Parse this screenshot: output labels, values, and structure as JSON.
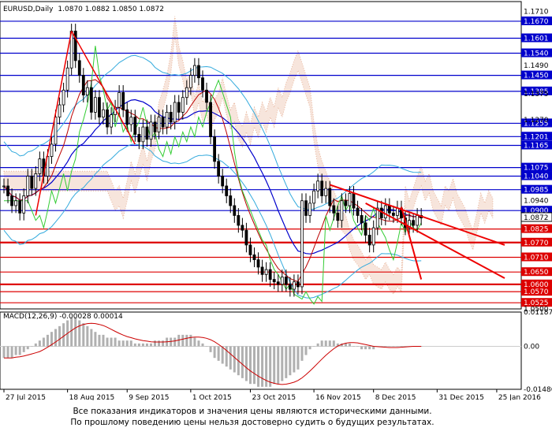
{
  "chart_data": [
    {
      "type": "candlestick",
      "title": "EURUSD,Daily",
      "ohlc_label": "1.0870 1.0882 1.0850 1.0872",
      "ylim": [
        1.05,
        1.175
      ],
      "x_ticks": [
        "27 Jul 2015",
        "18 Aug 2015",
        "9 Sep 2015",
        "1 Oct 2015",
        "23 Oct 2015",
        "16 Nov 2015",
        "8 Dec 2015",
        "31 Dec 2015",
        "25 Jan 2016"
      ],
      "price_ticks": [
        "1.1710",
        "1.1490",
        "1.1375",
        "1.1270",
        "1.0940",
        "1.0500"
      ],
      "levels_blue": [
        1.167,
        1.1601,
        1.154,
        1.145,
        1.1385,
        1.1255,
        1.1201,
        1.1165,
        1.1075,
        1.104,
        1.0985,
        1.09
      ],
      "levels_red": [
        1.0825,
        1.077,
        1.071,
        1.065,
        1.06,
        1.057,
        1.0525
      ],
      "current_price": "1.0872",
      "close": [
        1.1,
        1.096,
        1.092,
        1.094,
        1.089,
        1.096,
        1.104,
        1.099,
        1.105,
        1.111,
        1.104,
        1.112,
        1.117,
        1.128,
        1.133,
        1.139,
        1.148,
        1.163,
        1.151,
        1.145,
        1.137,
        1.14,
        1.13,
        1.136,
        1.128,
        1.131,
        1.124,
        1.129,
        1.132,
        1.138,
        1.131,
        1.125,
        1.128,
        1.121,
        1.118,
        1.124,
        1.119,
        1.126,
        1.122,
        1.128,
        1.124,
        1.13,
        1.126,
        1.134,
        1.13,
        1.136,
        1.14,
        1.145,
        1.149,
        1.144,
        1.139,
        1.134,
        1.12,
        1.11,
        1.104,
        1.1,
        1.096,
        1.092,
        1.088,
        1.084,
        1.082,
        1.076,
        1.072,
        1.07,
        1.067,
        1.064,
        1.066,
        1.062,
        1.061,
        1.06,
        1.063,
        1.06,
        1.058,
        1.061,
        1.059,
        1.094,
        1.088,
        1.093,
        1.098,
        1.102,
        1.096,
        1.099,
        1.092,
        1.089,
        1.086,
        1.094,
        1.092,
        1.097,
        1.091,
        1.088,
        1.085,
        1.08,
        1.076,
        1.083,
        1.091,
        1.087,
        1.092,
        1.089,
        1.088,
        1.091,
        1.087,
        1.083,
        1.086,
        1.084,
        1.088,
        1.087
      ]
    },
    {
      "type": "macd",
      "label": "MACD(12,26,9) -0.00028 0.00014",
      "ylim": [
        -0.01486,
        0.01187
      ],
      "y_ticks": [
        "0.01187",
        "0.00",
        "-0.01486"
      ],
      "histogram": [
        -0.004,
        -0.004,
        -0.004,
        -0.003,
        -0.003,
        -0.002,
        -0.001,
        0.0,
        0.001,
        0.002,
        0.003,
        0.004,
        0.005,
        0.006,
        0.007,
        0.008,
        0.009,
        0.01,
        0.01,
        0.009,
        0.008,
        0.007,
        0.006,
        0.005,
        0.004,
        0.004,
        0.003,
        0.003,
        0.003,
        0.002,
        0.002,
        0.002,
        0.002,
        0.001,
        0.001,
        0.001,
        0.001,
        0.001,
        0.002,
        0.002,
        0.002,
        0.003,
        0.003,
        0.003,
        0.004,
        0.004,
        0.004,
        0.004,
        0.003,
        0.002,
        0.001,
        0.0,
        -0.002,
        -0.004,
        -0.005,
        -0.006,
        -0.007,
        -0.008,
        -0.009,
        -0.01,
        -0.011,
        -0.012,
        -0.013,
        -0.013,
        -0.014,
        -0.014,
        -0.014,
        -0.014,
        -0.013,
        -0.013,
        -0.012,
        -0.011,
        -0.01,
        -0.009,
        -0.008,
        -0.005,
        -0.003,
        -0.001,
        0.0,
        0.001,
        0.002,
        0.002,
        0.002,
        0.002,
        0.001,
        0.001,
        0.001,
        0.001,
        0.0,
        0.0,
        -0.001,
        -0.001,
        -0.001,
        -0.001,
        0.0,
        0.0,
        0.0,
        0.0,
        0.0,
        0.0,
        0.0,
        0.0,
        0.0,
        0.0,
        0.0,
        0.0
      ]
    }
  ],
  "colors": {
    "candles": "#000000",
    "blue_level": "#0000cc",
    "red_level": "#dd0000",
    "trendline": "#ee0000",
    "bollinger": "#33aadd",
    "green": "#33cc33",
    "ma_blue": "#0000cc",
    "ma_red": "#bb0000",
    "ichimoku_cloud": "#e8b49a",
    "macd_hist": "#b0b0b0",
    "macd_signal": "#cc0000"
  },
  "disclaimer": [
    "Все показания индикаторов и значения цены являются историческими данными.",
    "По прошлому поведению цены нельзя достоверно судить о будущих результатах."
  ]
}
